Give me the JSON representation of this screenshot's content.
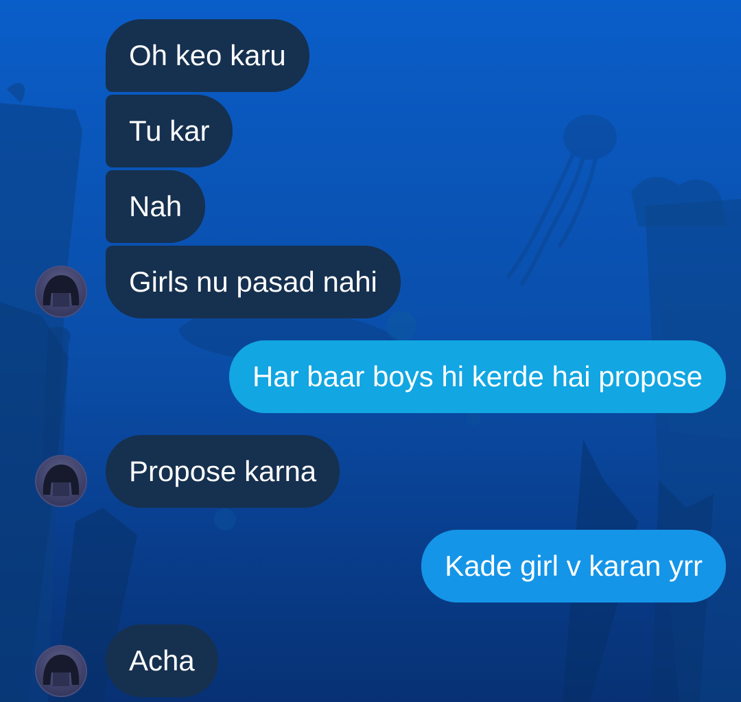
{
  "chat": {
    "messages": [
      {
        "sender": "other",
        "text": "Oh keo karu"
      },
      {
        "sender": "other",
        "text": "Tu kar"
      },
      {
        "sender": "other",
        "text": "Nah"
      },
      {
        "sender": "other",
        "text": "Girls nu pasad nahi"
      },
      {
        "sender": "me",
        "text": "Har baar boys hi kerde hai propose"
      },
      {
        "sender": "other",
        "text": "Propose karna"
      },
      {
        "sender": "me",
        "text": "Kade girl v karan yrr"
      },
      {
        "sender": "other",
        "text": "Acha"
      }
    ]
  },
  "colors": {
    "incoming_bubble": "#16304f",
    "outgoing_bubble_1": "#12a6e2",
    "outgoing_bubble_2": "#1595e8",
    "background_top": "#0a5ec9",
    "background_bottom": "#073174",
    "text": "#ffffff"
  },
  "icons": {
    "avatar": "contact-avatar-icon",
    "background": "underwater-wallpaper"
  }
}
